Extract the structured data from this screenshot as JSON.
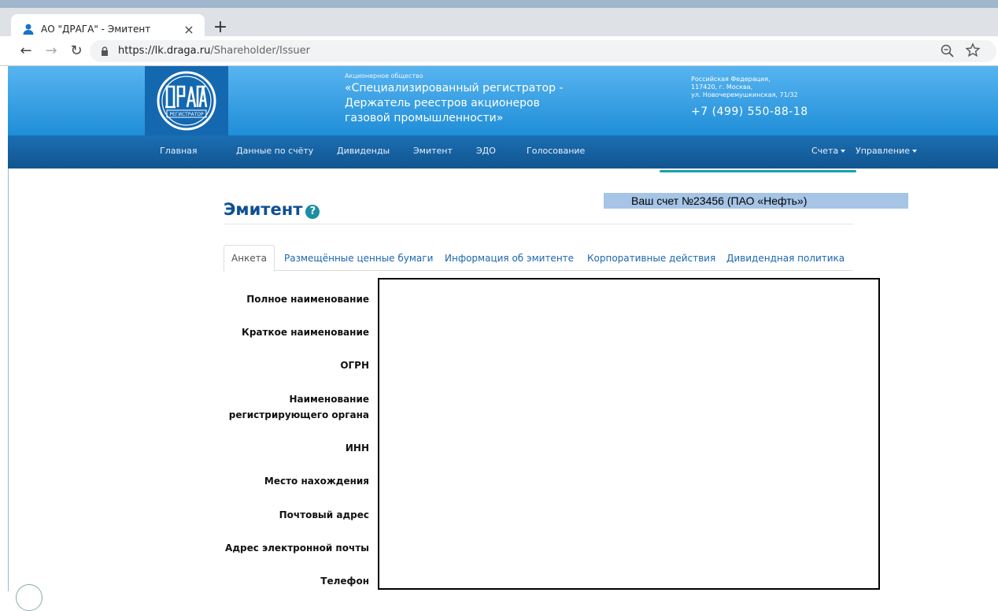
{
  "browser": {
    "tab_title": "АО \"ДРАГА\" - Эмитент",
    "tab_close": "×",
    "new_tab": "+",
    "back": "←",
    "forward": "→",
    "reload": "↻",
    "url_host": "https://lk.draga.ru",
    "url_path": "/Shareholder/Issuer"
  },
  "header": {
    "org_type": "Акционерное общество",
    "org_name": "«Специализированный регистратор - Держатель реестров акционеров газовой промышленности»",
    "address_line1": "Российская Федерация,",
    "address_line2": "117420, г. Москва,",
    "address_line3": "ул. Новочеремушкинская, 71/32",
    "phone": "+7 (499) 550-88-18"
  },
  "nav": {
    "home": "Главная",
    "account_data": "Данные по счёту",
    "dividends": "Дивиденды",
    "issuer": "Эмитент",
    "edo": "ЭДО",
    "voting": "Голосование",
    "accounts": "Счета",
    "management": "Управление"
  },
  "page": {
    "title": "Эмитент",
    "help": "?",
    "account_banner": "Ваш счет №23456  (ПАО «Нефть»)"
  },
  "tabs": {
    "questionnaire": "Анкета",
    "securities": "Размещённые ценные бумаги",
    "issuer_info": "Информация об эмитенте",
    "corporate_actions": "Корпоративные действия",
    "dividend_policy": "Дивидендная политика"
  },
  "fields": {
    "full_name": "Полное наименование",
    "short_name": "Краткое наименование",
    "ogrn": "ОГРН",
    "reg_authority_1": "Наименование",
    "reg_authority_2": "регистрирующего органа",
    "inn": "ИНН",
    "location": "Место нахождения",
    "postal_address": "Почтовый адрес",
    "email": "Адрес электронной почты",
    "phone": "Телефон"
  },
  "colors": {
    "header_blue": "#1f8ed8",
    "nav_blue": "#11548f",
    "title_blue": "#0f4f94",
    "banner": "#a6c4e6"
  }
}
